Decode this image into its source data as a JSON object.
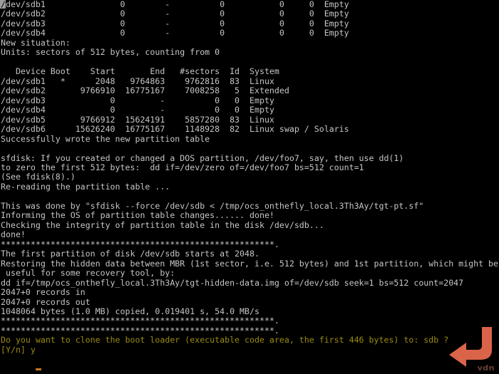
{
  "terminal": {
    "title": "Clonezilla sfdisk partition restore console",
    "colors": {
      "background": "#000000",
      "foreground": "#c6c6c6",
      "prompt_yellow": "#9a8b11",
      "cursor_block": "#9d9d9d",
      "cursor_underline": "#c07a18",
      "annotation_arrow": "#d9644a",
      "watermark": "#6a3f33"
    },
    "cursor": {
      "block_char": "/",
      "input_char": "y"
    },
    "annotation": {
      "arrow_icon": "curved-arrow-left-icon",
      "watermark_text": "vdn"
    },
    "old_table": {
      "rows": [
        {
          "device": "/dev/sdb1",
          "boot": "",
          "start": "0",
          "end": "-",
          "sectors": "0",
          "id": "0",
          "system": "Empty"
        },
        {
          "device": "/dev/sdb2",
          "boot": "",
          "start": "0",
          "end": "-",
          "sectors": "0",
          "id": "0",
          "system": "Empty"
        },
        {
          "device": "/dev/sdb3",
          "boot": "",
          "start": "0",
          "end": "-",
          "sectors": "0",
          "id": "0",
          "system": "Empty"
        },
        {
          "device": "/dev/sdb4",
          "boot": "",
          "start": "0",
          "end": "-",
          "sectors": "0",
          "id": "0",
          "system": "Empty"
        }
      ]
    },
    "new_table": {
      "heading": "New situation:",
      "units": "Units: sectors of 512 bytes, counting from 0",
      "columns": [
        "Device Boot",
        "Start",
        "End",
        "#sectors",
        "Id",
        "System"
      ],
      "rows": [
        {
          "device": "/dev/sdb1",
          "boot": "*",
          "start": "2048",
          "end": "9764863",
          "sectors": "9762816",
          "id": "83",
          "system": "Linux"
        },
        {
          "device": "/dev/sdb2",
          "boot": "",
          "start": "9766910",
          "end": "16775167",
          "sectors": "7008258",
          "id": "5",
          "system": "Extended"
        },
        {
          "device": "/dev/sdb3",
          "boot": "",
          "start": "0",
          "end": "-",
          "sectors": "0",
          "id": "0",
          "system": "Empty"
        },
        {
          "device": "/dev/sdb4",
          "boot": "",
          "start": "0",
          "end": "-",
          "sectors": "0",
          "id": "0",
          "system": "Empty"
        },
        {
          "device": "/dev/sdb5",
          "boot": "",
          "start": "9766912",
          "end": "15624191",
          "sectors": "5857280",
          "id": "83",
          "system": "Linux"
        },
        {
          "device": "/dev/sdb6",
          "boot": "",
          "start": "15626240",
          "end": "16775167",
          "sectors": "1148928",
          "id": "82",
          "system": "Linux swap / Solaris"
        }
      ]
    },
    "lines": [
      {
        "id": "l01",
        "cls": "",
        "text": "/dev/sdb1               0        -          0           0     0  Empty"
      },
      {
        "id": "l02",
        "cls": "",
        "text": "/dev/sdb2               0        -          0           0     0  Empty"
      },
      {
        "id": "l03",
        "cls": "",
        "text": "/dev/sdb3               0        -          0           0     0  Empty"
      },
      {
        "id": "l04",
        "cls": "",
        "text": "/dev/sdb4               0        -          0           0     0  Empty"
      },
      {
        "id": "l05",
        "cls": "",
        "text": "New situation:"
      },
      {
        "id": "l06",
        "cls": "",
        "text": "Units: sectors of 512 bytes, counting from 0"
      },
      {
        "id": "l07",
        "cls": "",
        "text": ""
      },
      {
        "id": "l08",
        "cls": "",
        "text": "   Device Boot    Start       End   #sectors  Id  System"
      },
      {
        "id": "l09",
        "cls": "",
        "text": "/dev/sdb1   *      2048   9764863    9762816  83  Linux"
      },
      {
        "id": "l10",
        "cls": "",
        "text": "/dev/sdb2       9766910  16775167    7008258   5  Extended"
      },
      {
        "id": "l11",
        "cls": "",
        "text": "/dev/sdb3             0         -          0   0  Empty"
      },
      {
        "id": "l12",
        "cls": "",
        "text": "/dev/sdb4             0         -          0   0  Empty"
      },
      {
        "id": "l13",
        "cls": "",
        "text": "/dev/sdb5       9766912  15624191    5857280  83  Linux"
      },
      {
        "id": "l14",
        "cls": "",
        "text": "/dev/sdb6      15626240  16775167    1148928  82  Linux swap / Solaris"
      },
      {
        "id": "l15",
        "cls": "",
        "text": "Successfully wrote the new partition table"
      },
      {
        "id": "l16",
        "cls": "",
        "text": ""
      },
      {
        "id": "l17",
        "cls": "",
        "text": "sfdisk: If you created or changed a DOS partition, /dev/foo7, say, then use dd(1)"
      },
      {
        "id": "l18",
        "cls": "",
        "text": "to zero the first 512 bytes:  dd if=/dev/zero of=/dev/foo7 bs=512 count=1"
      },
      {
        "id": "l19",
        "cls": "",
        "text": "(See fdisk(8).)"
      },
      {
        "id": "l20",
        "cls": "",
        "text": "Re-reading the partition table ..."
      },
      {
        "id": "l21",
        "cls": "",
        "text": ""
      },
      {
        "id": "l22",
        "cls": "",
        "text": "This was done by \"sfdisk --force /dev/sdb < /tmp/ocs_onthefly_local.3Th3Ay/tgt-pt.sf\""
      },
      {
        "id": "l23",
        "cls": "",
        "text": "Informing the OS of partition table changes...... done!"
      },
      {
        "id": "l24",
        "cls": "",
        "text": "Checking the integrity of partition table in the disk /dev/sdb..."
      },
      {
        "id": "l25",
        "cls": "",
        "text": "done!"
      },
      {
        "id": "l26",
        "cls": "stars",
        "text": "*******************************************************."
      },
      {
        "id": "l27",
        "cls": "",
        "text": "The first partition of disk /dev/sdb starts at 2048."
      },
      {
        "id": "l28",
        "cls": "",
        "text": "Restoring the hidden data between MBR (1st sector, i.e. 512 bytes) and 1st partition, which might be"
      },
      {
        "id": "l29",
        "cls": "",
        "text": " useful for some recovery tool, by:"
      },
      {
        "id": "l30",
        "cls": "",
        "text": "dd if=/tmp/ocs_onthefly_local.3Th3Ay/tgt-hidden-data.img of=/dev/sdb seek=1 bs=512 count=2047"
      },
      {
        "id": "l31",
        "cls": "",
        "text": "2047+0 records in"
      },
      {
        "id": "l32",
        "cls": "",
        "text": "2047+0 records out"
      },
      {
        "id": "l33",
        "cls": "",
        "text": "1048064 bytes (1.0 MB) copied, 0.019401 s, 54.0 MB/s"
      },
      {
        "id": "l34",
        "cls": "stars",
        "text": "*******************************************************."
      },
      {
        "id": "l35",
        "cls": "stars",
        "text": "*******************************************************."
      },
      {
        "id": "l36",
        "cls": "yellow",
        "text": "Do you want to clone the boot loader (executable code area, the first 446 bytes) to: sdb ?"
      },
      {
        "id": "l37",
        "cls": "yellow",
        "text": "[Y/n] y"
      }
    ]
  }
}
